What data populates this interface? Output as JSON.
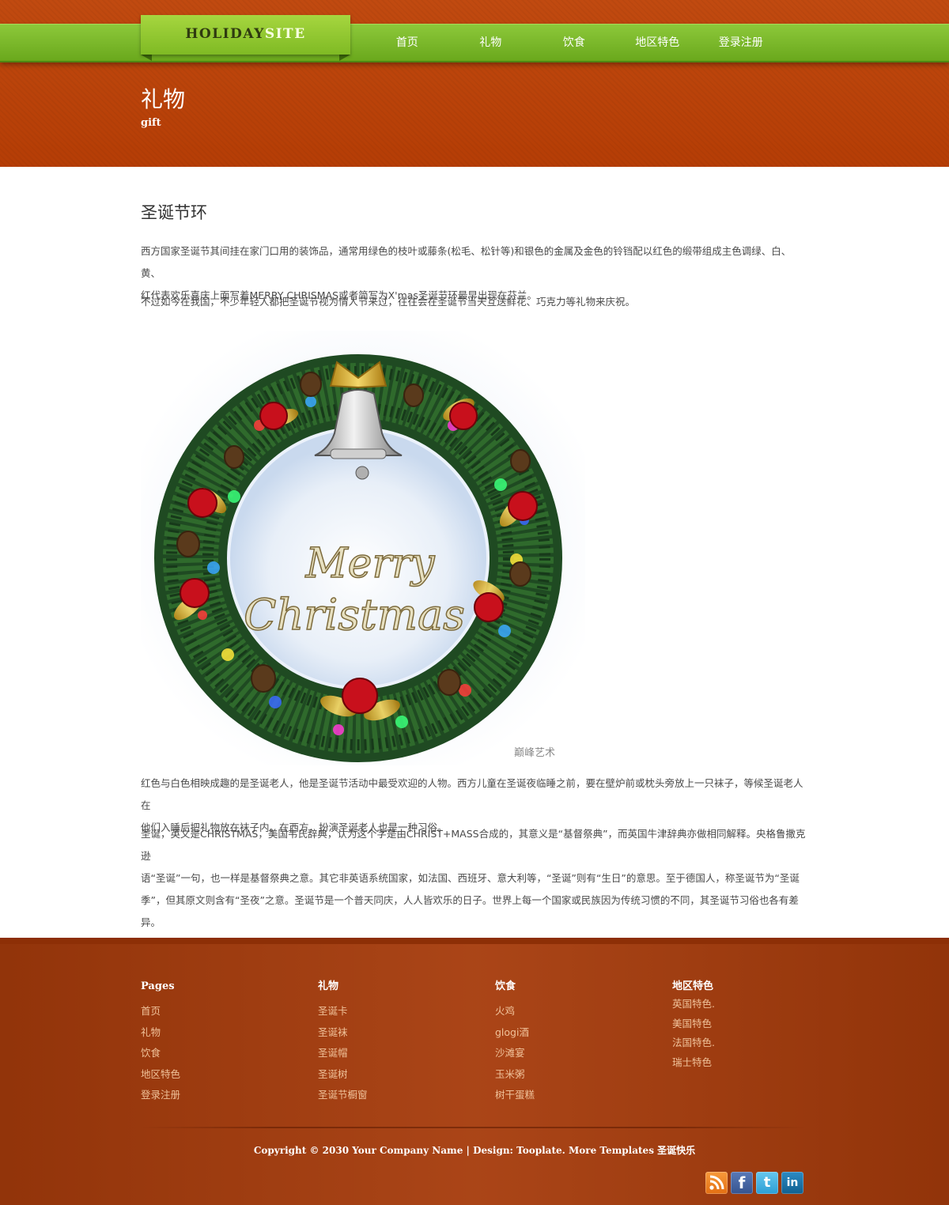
{
  "header": {
    "logo_part1": "HOLIDAY",
    "logo_part2": "SITE",
    "nav": [
      "首页",
      "礼物",
      "饮食",
      "地区特色",
      "登录注册"
    ],
    "page_title": "礼物",
    "page_subtitle": "gift"
  },
  "article": {
    "title": "圣诞节环",
    "para1_line1": "西方国家圣诞节其间挂在家门口用的装饰品，通常用绿色的枝叶或藤条(松毛、松针等)和银色的金属及金色的铃铛配以红色的缎带组成主色调绿、白、黄、",
    "para1_line2": "红代表欢乐喜庆上面写着MERRY CHRISMAS或者简写为X'mas圣诞节环最早出现在芬兰。",
    "para2": "不过如今在我国，不少年轻人都把圣诞节视为情人节来过，往往会在圣诞节当天互送鲜花、巧克力等礼物来庆祝。",
    "image": {
      "text_line1": "Merry",
      "text_line2": "Christmas",
      "watermark": "巅峰艺术"
    },
    "para3_line1": "红色与白色相映成趣的是圣诞老人，他是圣诞节活动中最受欢迎的人物。西方儿童在圣诞夜临睡之前，要在壁炉前或枕头旁放上一只袜子，等候圣诞老人在",
    "para3_line2": "他们入睡后把礼物放在袜子内。在西方，扮演圣诞老人也是一种习俗。",
    "para4_line1": "圣诞，英文是CHRISTMAS，美国韦氏辞典，认为这个字是由CHRIST+MASS合成的，其意义是“基督祭典”，而英国牛津辞典亦做相同解释。央格鲁撒克逊",
    "para4_line2": "语“圣诞”一句，也一样是基督祭典之意。其它非英语系统国家，如法国、西班牙、意大利等，“圣诞”则有“生日”的意思。至于德国人，称圣诞节为“圣诞",
    "para4_line3": "季”，但其原文则含有“圣夜”之意。圣诞节是一个普天同庆，人人皆欢乐的日子。世界上每一个国家或民族因为传统习惯的不同，其圣诞节习俗也各有差异。"
  },
  "footer": {
    "columns": [
      {
        "heading": "Pages",
        "links": [
          "首页",
          "礼物",
          "饮食",
          "地区特色",
          "登录注册"
        ]
      },
      {
        "heading": "礼物",
        "links": [
          "圣诞卡",
          "圣诞袜",
          "圣诞帽",
          "圣诞树",
          "圣诞节橱窗"
        ]
      },
      {
        "heading": "饮食",
        "links": [
          "火鸡",
          "glogi酒",
          "沙滩宴",
          "玉米粥",
          "树干蛋糕"
        ]
      },
      {
        "heading": "地区特色",
        "links": [
          "英国特色.",
          "美国特色",
          "法国特色.",
          "瑞士特色"
        ]
      }
    ],
    "copyright": "Copyright © 2030 Your Company Name | Design: Tooplate. More Templates 圣诞快乐",
    "social": [
      {
        "icon": "rss-icon",
        "glyph": ""
      },
      {
        "icon": "facebook-icon",
        "glyph": "f"
      },
      {
        "icon": "twitter-icon",
        "glyph": "t"
      },
      {
        "icon": "linkedin-icon",
        "glyph": "in"
      }
    ]
  },
  "colors": {
    "header_bg": "#b93f06",
    "nav_green": "#7ab82a",
    "footer_bg": "#a63b0b",
    "footer_link": "#f0c29a"
  }
}
